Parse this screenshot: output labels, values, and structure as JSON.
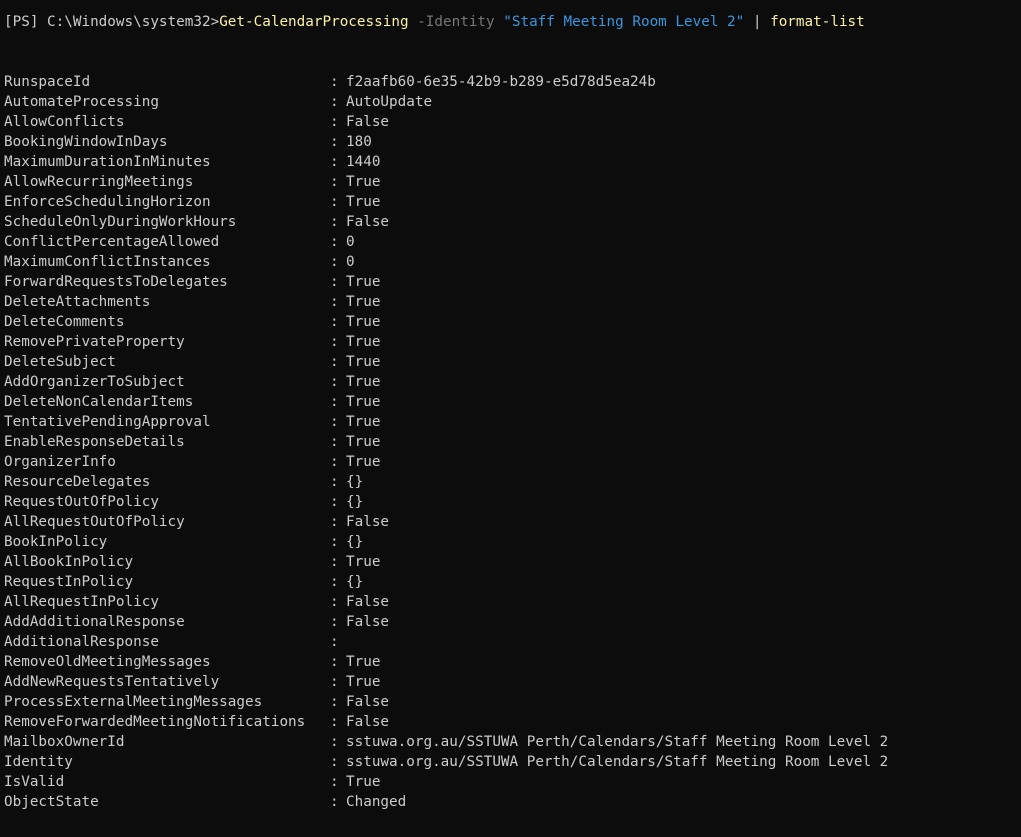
{
  "command": {
    "prompt": "[PS] C:\\Windows\\system32>",
    "cmdlet": "Get-CalendarProcessing",
    "param": "-Identity",
    "arg": "\"Staff Meeting Room Level 2\"",
    "pipe": "|",
    "pipe_cmd": "format-list"
  },
  "separator": ":",
  "properties": [
    {
      "name": "RunspaceId",
      "value": "f2aafb60-6e35-42b9-b289-e5d78d5ea24b"
    },
    {
      "name": "AutomateProcessing",
      "value": "AutoUpdate"
    },
    {
      "name": "AllowConflicts",
      "value": "False"
    },
    {
      "name": "BookingWindowInDays",
      "value": "180"
    },
    {
      "name": "MaximumDurationInMinutes",
      "value": "1440"
    },
    {
      "name": "AllowRecurringMeetings",
      "value": "True"
    },
    {
      "name": "EnforceSchedulingHorizon",
      "value": "True"
    },
    {
      "name": "ScheduleOnlyDuringWorkHours",
      "value": "False"
    },
    {
      "name": "ConflictPercentageAllowed",
      "value": "0"
    },
    {
      "name": "MaximumConflictInstances",
      "value": "0"
    },
    {
      "name": "ForwardRequestsToDelegates",
      "value": "True"
    },
    {
      "name": "DeleteAttachments",
      "value": "True"
    },
    {
      "name": "DeleteComments",
      "value": "True"
    },
    {
      "name": "RemovePrivateProperty",
      "value": "True"
    },
    {
      "name": "DeleteSubject",
      "value": "True"
    },
    {
      "name": "AddOrganizerToSubject",
      "value": "True"
    },
    {
      "name": "DeleteNonCalendarItems",
      "value": "True"
    },
    {
      "name": "TentativePendingApproval",
      "value": "True"
    },
    {
      "name": "EnableResponseDetails",
      "value": "True"
    },
    {
      "name": "OrganizerInfo",
      "value": "True"
    },
    {
      "name": "ResourceDelegates",
      "value": "{}"
    },
    {
      "name": "RequestOutOfPolicy",
      "value": "{}"
    },
    {
      "name": "AllRequestOutOfPolicy",
      "value": "False"
    },
    {
      "name": "BookInPolicy",
      "value": "{}"
    },
    {
      "name": "AllBookInPolicy",
      "value": "True"
    },
    {
      "name": "RequestInPolicy",
      "value": "{}"
    },
    {
      "name": "AllRequestInPolicy",
      "value": "False"
    },
    {
      "name": "AddAdditionalResponse",
      "value": "False"
    },
    {
      "name": "AdditionalResponse",
      "value": ""
    },
    {
      "name": "RemoveOldMeetingMessages",
      "value": "True"
    },
    {
      "name": "AddNewRequestsTentatively",
      "value": "True"
    },
    {
      "name": "ProcessExternalMeetingMessages",
      "value": "False"
    },
    {
      "name": "RemoveForwardedMeetingNotifications",
      "value": "False"
    },
    {
      "name": "MailboxOwnerId",
      "value": "sstuwa.org.au/SSTUWA Perth/Calendars/Staff Meeting Room Level 2"
    },
    {
      "name": "Identity",
      "value": "sstuwa.org.au/SSTUWA Perth/Calendars/Staff Meeting Room Level 2"
    },
    {
      "name": "IsValid",
      "value": "True"
    },
    {
      "name": "ObjectState",
      "value": "Changed"
    }
  ],
  "colors": {
    "background": "#0c0c0c",
    "text": "#cccccc",
    "cmdlet": "#f9f1a5",
    "parameter": "#767676",
    "string": "#3a96dd"
  }
}
